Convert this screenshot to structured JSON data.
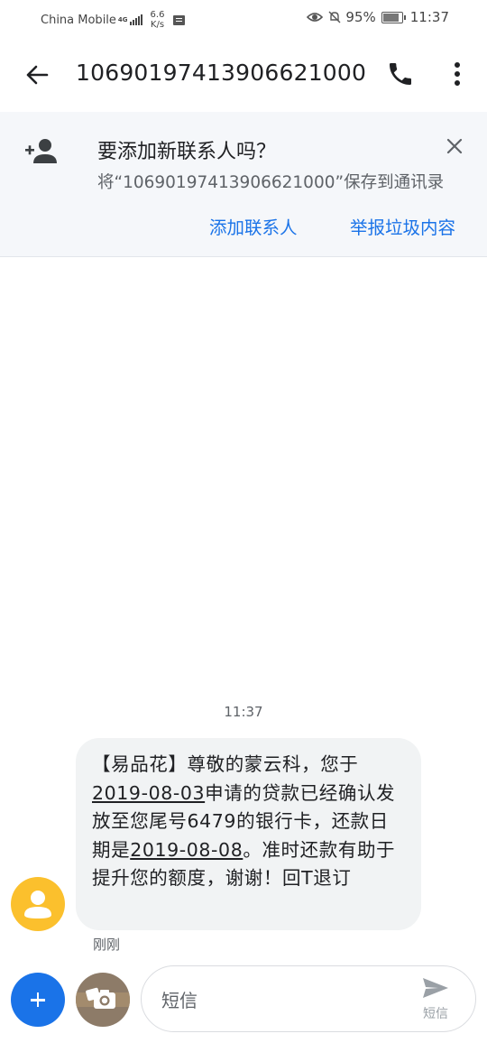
{
  "status_bar": {
    "carrier": "China Mobile",
    "network": "4G",
    "speed_value": "6.6",
    "speed_unit": "K/s",
    "battery": "95%",
    "time": "11:37"
  },
  "app_bar": {
    "title": "10690197413906621000",
    "icons": [
      "back-arrow-icon",
      "phone-icon",
      "more-vert-icon"
    ]
  },
  "banner": {
    "title": "要添加新联系人吗？",
    "subtitle": "将“10690197413906621000”保存到通讯录",
    "add_contact": "添加联系人",
    "report_spam": "举报垃圾内容"
  },
  "conversation": {
    "timestamp": "11:37",
    "message": {
      "part1": "【易品花】尊敬的蒙云科，您于",
      "date1": "2019-08-03",
      "part2": "申请的贷款已经确认发放至您尾号6479的银行卡，还款日期是",
      "date2": "2019-08-08",
      "part3": "。准时还款有助于提升您的额度，谢谢！回T退订"
    },
    "time_label": "刚刚"
  },
  "compose": {
    "placeholder": "短信",
    "send_label": "短信"
  },
  "colors": {
    "accent": "#1a73e8",
    "avatar": "#fbc02d",
    "bubble": "#f1f3f4",
    "banner": "#f5f7fa"
  }
}
